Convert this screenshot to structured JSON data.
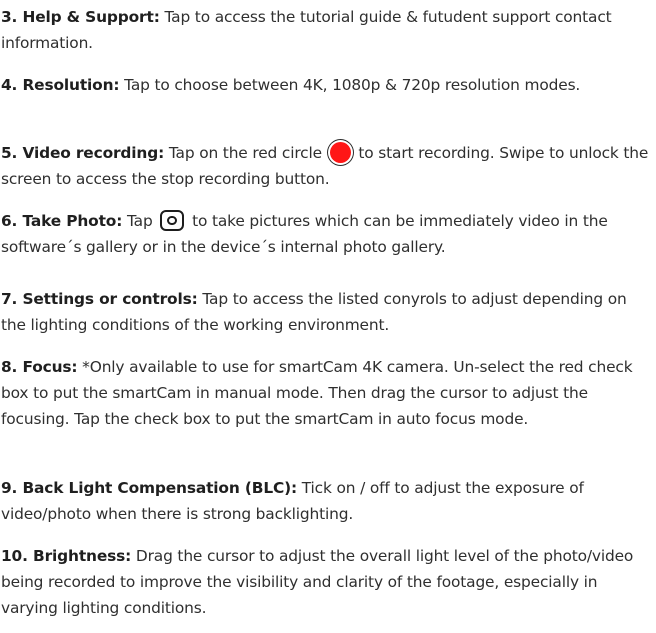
{
  "items": [
    {
      "label": "3. Help & Support:",
      "text": " Tap to access the tutorial guide & futudent support contact information."
    },
    {
      "label": "4. Resolution:",
      "text": " Tap to choose between 4K, 1080p & 720p resolution modes."
    },
    {
      "label": "5. Video recording:",
      "text_before": " Tap on the red circle ",
      "text_after": " to start recording. Swipe to unlock the screen to access the stop recording button.",
      "icon": "record-icon",
      "icon_color": "#ff1616"
    },
    {
      "label": "6. Take Photo:",
      "text_before": " Tap ",
      "text_after": " to take pictures which can be immediately video in the software´s gallery or in the device´s internal photo gallery.",
      "icon": "camera-icon"
    },
    {
      "label": "7. Settings or controls:",
      "text": " Tap to access the listed conyrols to adjust depending on the lighting conditions of the working environment."
    },
    {
      "label": "8. Focus:",
      "text": " *Only available to use for smartCam 4K camera. Un-select the red check box to put the smartCam in manual mode. Then drag the cursor to adjust the focusing. Tap the check box to put the smartCam in auto focus mode."
    },
    {
      "label": "9. Back Light Compensation (BLC):",
      "text": " Tick on / off to adjust the exposure of video/photo when there is strong backlighting."
    },
    {
      "label": "10. Brightness:",
      "text": " Drag the cursor to adjust the overall light level of the photo/video being recorded to improve the visibility and clarity of the footage, especially in varying lighting conditions."
    }
  ]
}
